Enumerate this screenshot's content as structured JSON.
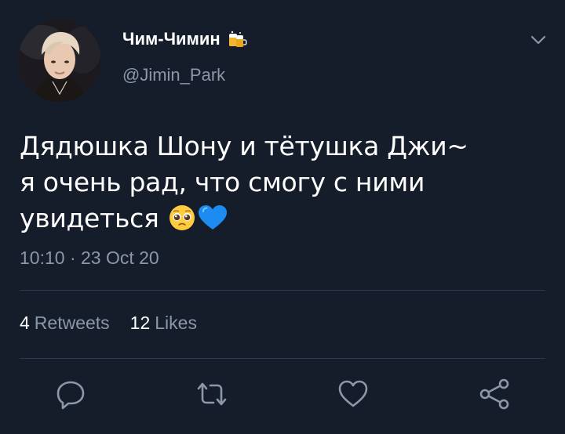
{
  "tweet": {
    "author": {
      "display_name": "Чим-Чимин",
      "handle": "@Jimin_Park",
      "name_emoji_icon": "beer-mugs-icon",
      "avatar_icon": "profile-avatar"
    },
    "text_lines": [
      "Дядюшка Шону и тётушка Джи~",
      "я очень рад, что смогу с ними",
      "увидеться"
    ],
    "text_emojis": [
      "pleading-face-icon",
      "blue-heart-icon"
    ],
    "timestamp": "10:10 · 23 Oct 20",
    "stats": {
      "retweets_count": "4",
      "retweets_label": "Retweets",
      "likes_count": "12",
      "likes_label": "Likes"
    },
    "actions": [
      "reply-icon",
      "retweet-icon",
      "like-icon",
      "share-icon"
    ],
    "menu_icon": "chevron-down-icon"
  },
  "colors": {
    "background": "#151d2b",
    "primary_text": "#ffffff",
    "secondary_text": "#8b98a5",
    "divider": "#2f3b4b",
    "blue_heart": "#1d8cf0"
  }
}
